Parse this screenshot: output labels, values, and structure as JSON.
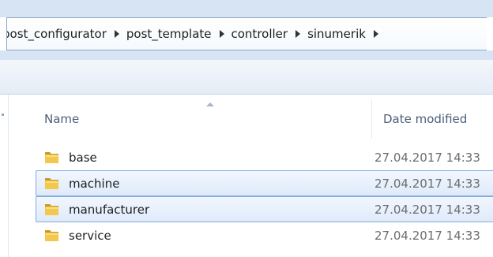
{
  "breadcrumb": {
    "items": [
      {
        "label": "post_configurator"
      },
      {
        "label": "post_template"
      },
      {
        "label": "controller"
      },
      {
        "label": "sinumerik"
      }
    ]
  },
  "columns": {
    "name": "Name",
    "date_modified": "Date modified"
  },
  "files": [
    {
      "name": "base",
      "date": "27.04.2017 14:33",
      "icon": "folder-icon",
      "selected": false
    },
    {
      "name": "machine",
      "date": "27.04.2017 14:33",
      "icon": "folder-icon",
      "selected": true
    },
    {
      "name": "manufacturer",
      "date": "27.04.2017 14:33",
      "icon": "folder-icon",
      "selected": true
    },
    {
      "name": "service",
      "date": "27.04.2017 14:33",
      "icon": "folder-icon",
      "selected": false
    }
  ],
  "colors": {
    "selection_fill": "#dfeafa",
    "selection_border": "#84acdd",
    "chrome": "#d6e4f3",
    "folder": "#e8b93a"
  }
}
